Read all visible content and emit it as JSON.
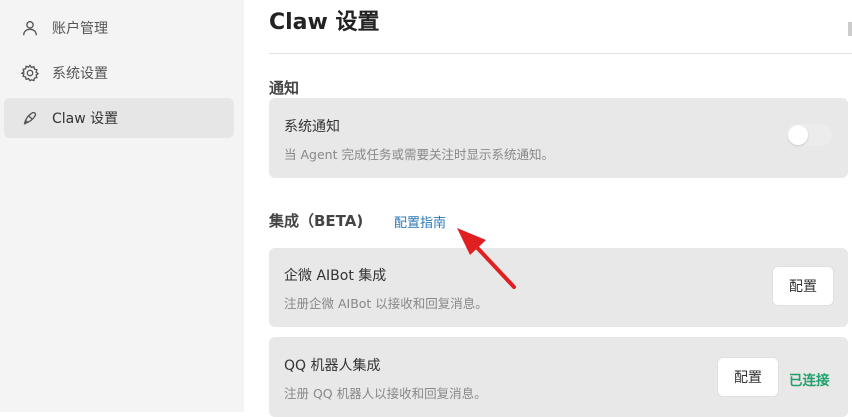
{
  "sidebar": {
    "items": [
      {
        "label": "账户管理",
        "icon": "user-icon",
        "active": false
      },
      {
        "label": "系统设置",
        "icon": "gear-icon",
        "active": false
      },
      {
        "label": "Claw 设置",
        "icon": "claw-icon",
        "active": true
      }
    ]
  },
  "page": {
    "title": "Claw 设置"
  },
  "notifications": {
    "section_title": "通知",
    "system": {
      "title": "系统通知",
      "description": "当 Agent 完成任务或需要关注时显示系统通知。",
      "enabled": false
    }
  },
  "integration": {
    "section_title": "集成（BETA)",
    "guide_link": "配置指南",
    "items": [
      {
        "title": "企微 AIBot 集成",
        "description": "注册企微 AIBot 以接收和回复消息。",
        "button": "配置",
        "status": ""
      },
      {
        "title": "QQ 机器人集成",
        "description": "注册 QQ 机器人以接收和回复消息。",
        "button": "配置",
        "status": "已连接"
      }
    ]
  },
  "colors": {
    "accent_link": "#2b78b8",
    "status_connected": "#22a06b",
    "annotation_arrow": "#e02020"
  }
}
